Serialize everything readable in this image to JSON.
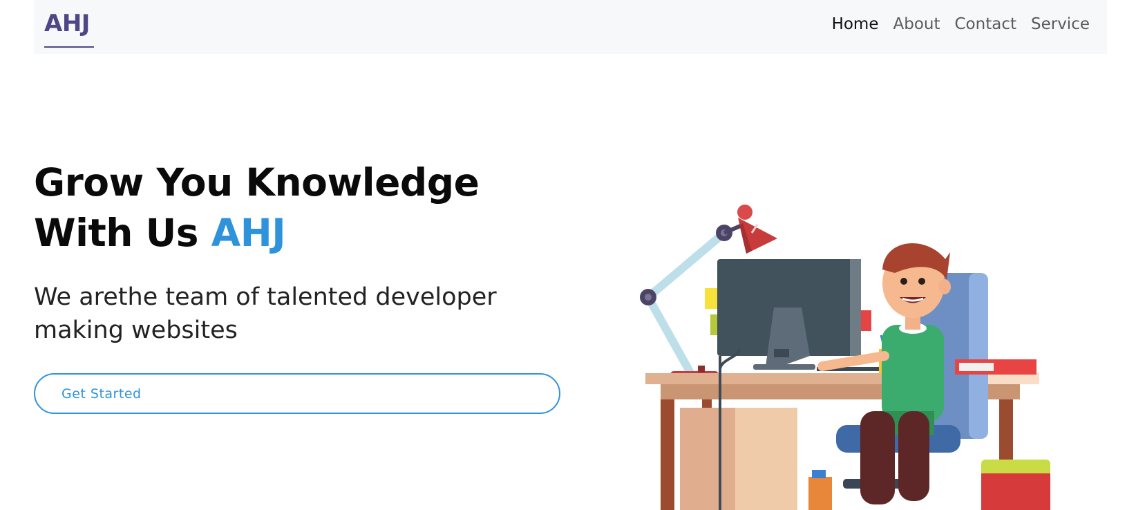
{
  "navbar": {
    "brand": "AHJ",
    "links": [
      {
        "label": "Home",
        "active": true
      },
      {
        "label": "About",
        "active": false
      },
      {
        "label": "Contact",
        "active": false
      },
      {
        "label": "Service",
        "active": false
      }
    ]
  },
  "hero": {
    "title_main": "Grow You Knowledge With Us",
    "title_accent": "AHJ",
    "subtitle": "We arethe team of talented developer making websites",
    "cta_label": "Get Started"
  },
  "colors": {
    "brand": "#4e4786",
    "accent": "#2f93db",
    "navbar_bg": "#f7f8fa"
  },
  "icons": [
    "developer-desk-illustration"
  ]
}
